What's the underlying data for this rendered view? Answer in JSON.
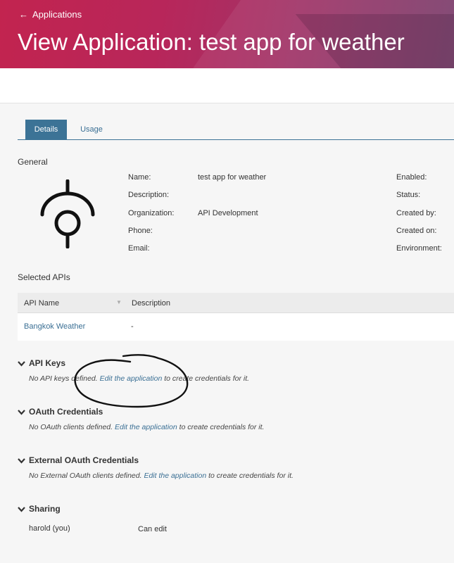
{
  "header": {
    "back_label": "Applications",
    "title": "View Application: test app for weather"
  },
  "tabs": [
    {
      "label": "Details",
      "active": true
    },
    {
      "label": "Usage",
      "active": false
    }
  ],
  "general": {
    "section_label": "General",
    "fields_left": [
      {
        "label": "Name:",
        "value": "test app for weather"
      },
      {
        "label": "Description:",
        "value": ""
      },
      {
        "label": "Organization:",
        "value": "API Development"
      },
      {
        "label": "Phone:",
        "value": ""
      },
      {
        "label": "Email:",
        "value": ""
      }
    ],
    "fields_right": [
      {
        "label": "Enabled:"
      },
      {
        "label": "Status:"
      },
      {
        "label": "Created by:"
      },
      {
        "label": "Created on:"
      },
      {
        "label": "Environment:"
      }
    ]
  },
  "selected_apis": {
    "section_label": "Selected APIs",
    "columns": [
      "API Name",
      "Description"
    ],
    "rows": [
      {
        "name": "Bangkok Weather",
        "description": "-"
      }
    ]
  },
  "credentials": [
    {
      "title": "API Keys",
      "prefix": "No API keys defined.",
      "link": "Edit the application",
      "suffix": "to create credentials for it."
    },
    {
      "title": "OAuth Credentials",
      "prefix": "No OAuth clients defined.",
      "link": "Edit the application",
      "suffix": "to create credentials for it."
    },
    {
      "title": "External OAuth Credentials",
      "prefix": "No External OAuth clients defined.",
      "link": "Edit the application",
      "suffix": "to create credentials for it."
    }
  ],
  "sharing": {
    "title": "Sharing",
    "entries": [
      {
        "user": "harold (you)",
        "permission": "Can edit"
      }
    ]
  },
  "colors": {
    "accent": "#3c7396",
    "link": "#3a6f94",
    "banner_start": "#c2244f",
    "banner_end": "#7a3f6c"
  }
}
